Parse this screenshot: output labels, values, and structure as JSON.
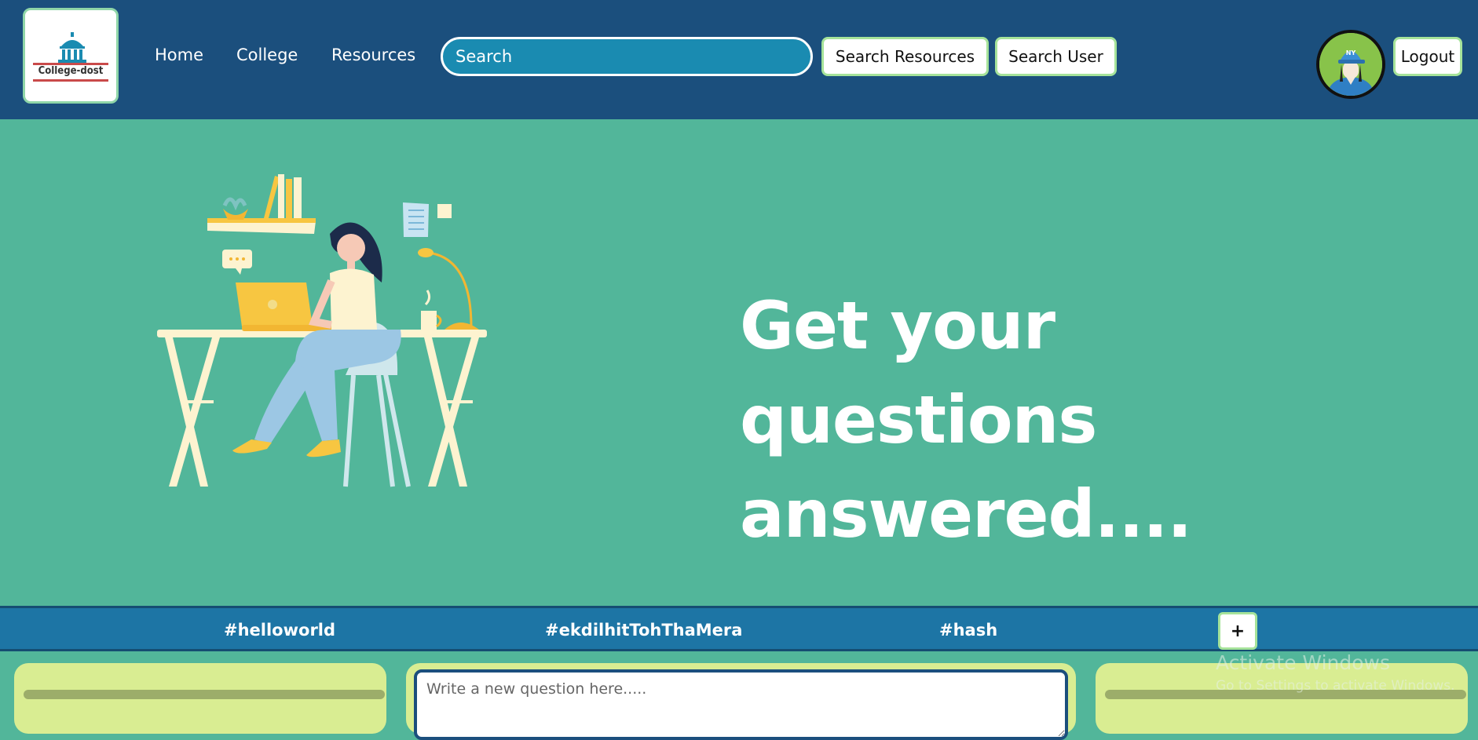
{
  "navbar": {
    "logo_text": "College-dost",
    "links": [
      "Home",
      "College",
      "Resources"
    ],
    "search_placeholder": "Search",
    "search_resources_label": "Search Resources",
    "search_user_label": "Search User",
    "logout_label": "Logout",
    "avatar_cap_text": "NY"
  },
  "hero": {
    "title_line1": "Get your questions",
    "title_line2": "answered...."
  },
  "hashtags": {
    "tags": [
      "#helloworld",
      "#ekdilhitTohThaMera",
      "#hash"
    ],
    "add_label": "+"
  },
  "ask": {
    "placeholder": "Write a new question here....."
  },
  "watermark": {
    "title": "Activate Windows",
    "subtitle": "Go to Settings to activate Windows."
  },
  "colors": {
    "navbar_bg": "#1b4f7d",
    "hero_bg": "#52b69a",
    "search_bg": "#1a8bb1",
    "hashbar_bg": "#1d75a5",
    "card_bg": "#d9ed92",
    "button_border": "#a6e39a"
  }
}
